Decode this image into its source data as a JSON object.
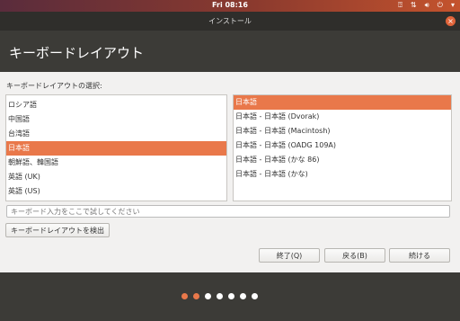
{
  "topbar": {
    "clock": "Fri 08:16"
  },
  "tray_icons": [
    "accessibility-icon",
    "network-icon",
    "volume-icon",
    "power-icon",
    "menu-arrow-icon"
  ],
  "window": {
    "title": "インストール"
  },
  "header": {
    "title": "キーボードレイアウト"
  },
  "prompt": "キーボードレイアウトの選択:",
  "languages": [
    {
      "label": "ロシア語",
      "selected": false
    },
    {
      "label": "中国語",
      "selected": false
    },
    {
      "label": "台湾語",
      "selected": false
    },
    {
      "label": "日本語",
      "selected": true
    },
    {
      "label": "朝鮮語、韓国語",
      "selected": false
    },
    {
      "label": "英語 (UK)",
      "selected": false
    },
    {
      "label": "英語 (US)",
      "selected": false
    }
  ],
  "layouts": [
    {
      "label": "日本語",
      "selected": true
    },
    {
      "label": "日本語 - 日本語 (Dvorak)",
      "selected": false
    },
    {
      "label": "日本語 - 日本語 (Macintosh)",
      "selected": false
    },
    {
      "label": "日本語 - 日本語 (OADG 109A)",
      "selected": false
    },
    {
      "label": "日本語 - 日本語 (かな 86)",
      "selected": false
    },
    {
      "label": "日本語 - 日本語 (かな)",
      "selected": false
    }
  ],
  "test_input": {
    "placeholder": "キーボード入力をここで試してください",
    "value": ""
  },
  "buttons": {
    "detect": "キーボードレイアウトを検出",
    "quit": "終了(Q)",
    "back": "戻る(B)",
    "continue": "続ける"
  },
  "progress": {
    "total_steps": 7,
    "current_step": 2
  },
  "colors": {
    "accent": "#e9784a",
    "header_bg": "#3c3b37"
  }
}
